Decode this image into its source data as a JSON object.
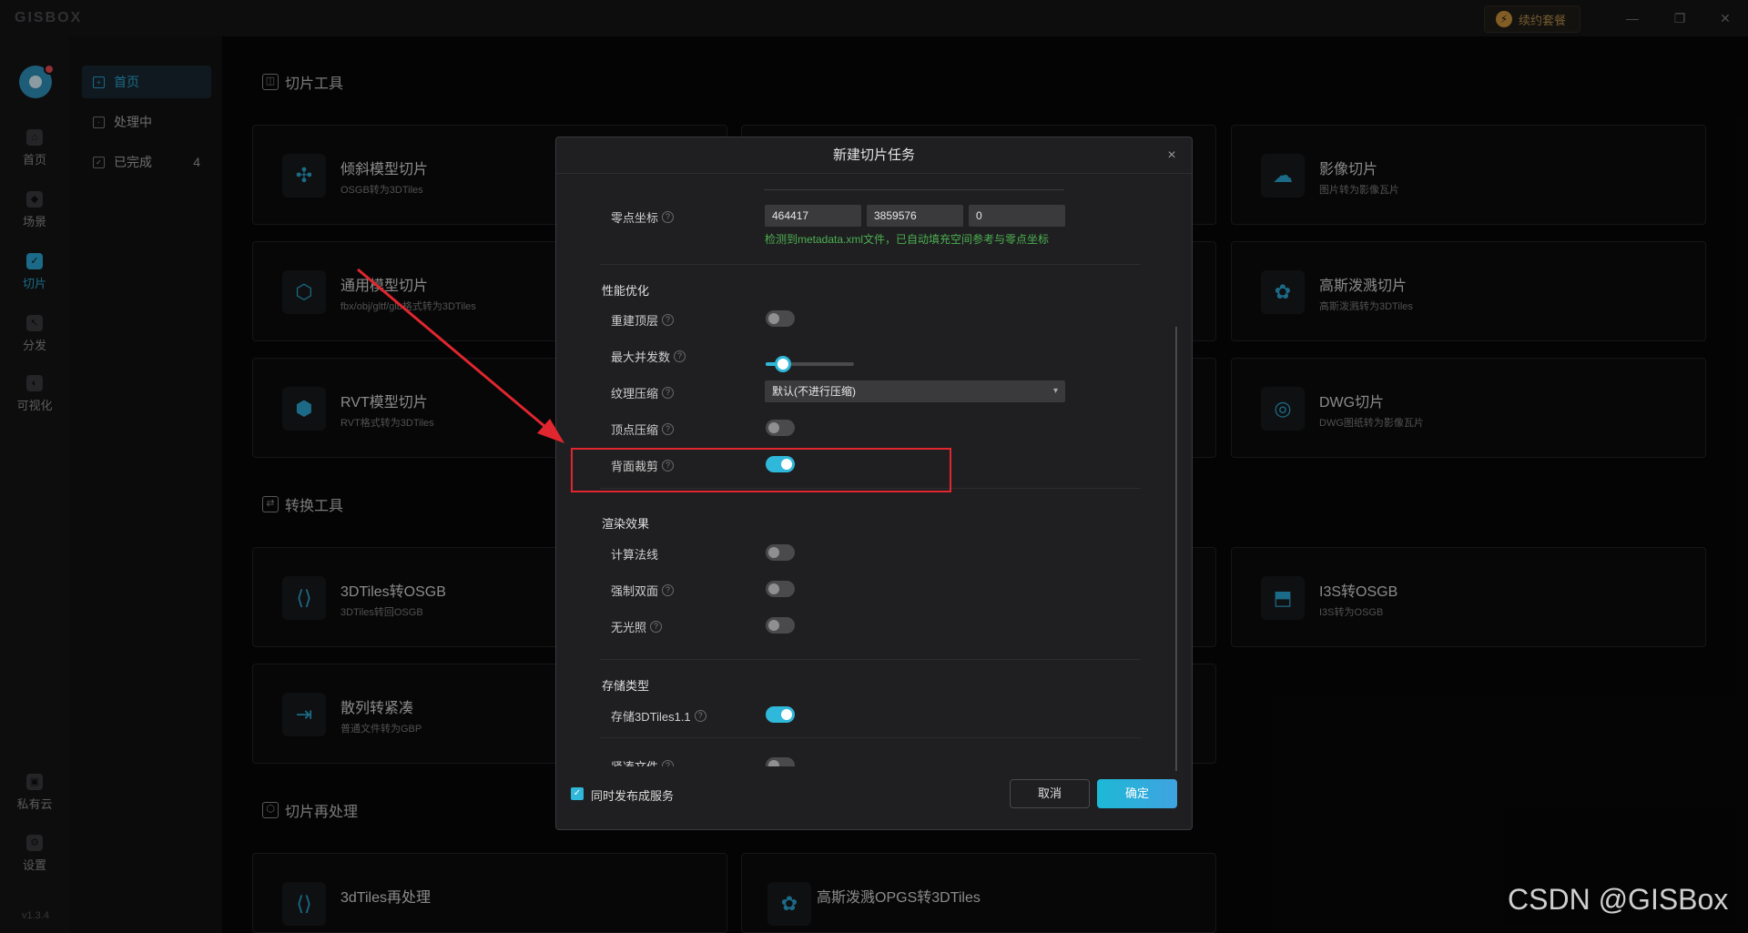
{
  "app": {
    "logo": "GISBOX",
    "renew_label": "续约套餐",
    "version": "v1.3.4"
  },
  "window_controls": {
    "minimize": "—",
    "restore": "❐",
    "close": "✕"
  },
  "leftbar": {
    "items": [
      {
        "label": "首页",
        "icon": "home-icon"
      },
      {
        "label": "场景",
        "icon": "cube-icon"
      },
      {
        "label": "切片",
        "icon": "slice-icon"
      },
      {
        "label": "分发",
        "icon": "share-icon"
      },
      {
        "label": "可视化",
        "icon": "chart-icon"
      }
    ],
    "bottom": [
      {
        "label": "私有云",
        "icon": "lock-icon"
      },
      {
        "label": "设置",
        "icon": "gear-icon"
      }
    ]
  },
  "sidepanel": {
    "items": [
      {
        "label": "首页",
        "count": ""
      },
      {
        "label": "处理中",
        "count": ""
      },
      {
        "label": "已完成",
        "count": "4"
      }
    ]
  },
  "sections": {
    "slice_tools": "切片工具",
    "convert_tools": "转换工具",
    "reprocess": "切片再处理"
  },
  "cards": {
    "oblique": {
      "title": "倾斜模型切片",
      "sub": "OSGB转为3DTiles"
    },
    "general": {
      "title": "通用模型切片",
      "sub": "fbx/obj/gltf/glb格式转为3DTiles"
    },
    "rvt": {
      "title": "RVT模型切片",
      "sub": "RVT格式转为3DTiles"
    },
    "image": {
      "title": "影像切片",
      "sub": "图片转为影像瓦片"
    },
    "gauss": {
      "title": "高斯泼溅切片",
      "sub": "高斯泼溅转为3DTiles"
    },
    "dwg": {
      "title": "DWG切片",
      "sub": "DWG图纸转为影像瓦片"
    },
    "tiles2osgb": {
      "title": "3DTiles转OSGB",
      "sub": "3DTiles转回OSGB"
    },
    "i3s2osgb": {
      "title": "I3S转OSGB",
      "sub": "I3S转为OSGB"
    },
    "scatter": {
      "title": "散列转紧凑",
      "sub": "普通文件转为GBP"
    },
    "reprocess": {
      "title": "3dTiles再处理",
      "sub": ""
    },
    "gauss_opgs": {
      "title": "高斯泼溅OPGS转3DTiles",
      "sub": ""
    }
  },
  "dialog": {
    "title": "新建切片任务",
    "close": "×",
    "origin": {
      "label": "零点坐标",
      "x": "464417",
      "y": "3859576",
      "z": "0",
      "hint": "检测到metadata.xml文件，已自动填充空间参考与零点坐标"
    },
    "perf": {
      "group": "性能优化",
      "rebuild_top": {
        "label": "重建顶层",
        "on": false
      },
      "max_concurrency": {
        "label": "最大并发数",
        "fraction": 0.2
      },
      "texture": {
        "label": "纹理压缩",
        "value": "默认(不进行压缩)"
      },
      "vertex": {
        "label": "顶点压缩",
        "on": false
      },
      "backface": {
        "label": "背面裁剪",
        "on": true
      }
    },
    "render": {
      "group": "渲染效果",
      "normals": {
        "label": "计算法线",
        "on": false
      },
      "double_sided": {
        "label": "强制双面",
        "on": false
      },
      "unlit": {
        "label": "无光照",
        "on": false
      }
    },
    "storage": {
      "group": "存储类型",
      "tiles11": {
        "label": "存储3DTiles1.1",
        "on": true
      },
      "compact": {
        "label": "紧凑文件",
        "on": false
      }
    },
    "footer": {
      "publish_label": "同时发布成服务",
      "cancel": "取消",
      "ok": "确定"
    }
  },
  "watermark": "CSDN @GISBox",
  "colors": {
    "accent": "#2fb8da",
    "highlight": "#e0262e",
    "hint": "#4caf50"
  }
}
